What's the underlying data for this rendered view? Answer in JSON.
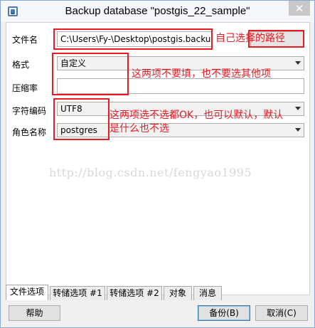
{
  "window": {
    "title": "Backup database \"postgis_22_sample\"",
    "close_glyph": "✕",
    "icon": "database-icon"
  },
  "form": {
    "filename": {
      "label": "文件名",
      "value": "C:\\Users\\Fy-\\Desktop\\postgis.backup"
    },
    "format": {
      "label": "格式",
      "value": "自定义"
    },
    "compression": {
      "label": "压缩率",
      "value": ""
    },
    "encoding": {
      "label": "字符编码",
      "value": "UTF8"
    },
    "role": {
      "label": "角色名称",
      "value": "postgres"
    }
  },
  "annotations": {
    "filename_note": "自己选择的路径",
    "format_note": "这两项不要填，也不要选其他项",
    "encoding_note_line1": "这两项选不选都OK，也可以默认，默认",
    "encoding_note_line2": "是什么也不选",
    "watermark": "http://blog.csdn.net/fengyao1995",
    "color": "#e81b23"
  },
  "tabs": [
    {
      "label": "文件选项"
    },
    {
      "label": "转储选项 #1"
    },
    {
      "label": "转储选项 #2"
    },
    {
      "label": "对象"
    },
    {
      "label": "消息"
    }
  ],
  "buttons": {
    "help": "帮助",
    "backup": "备份(B)",
    "cancel": "取消(C)"
  }
}
